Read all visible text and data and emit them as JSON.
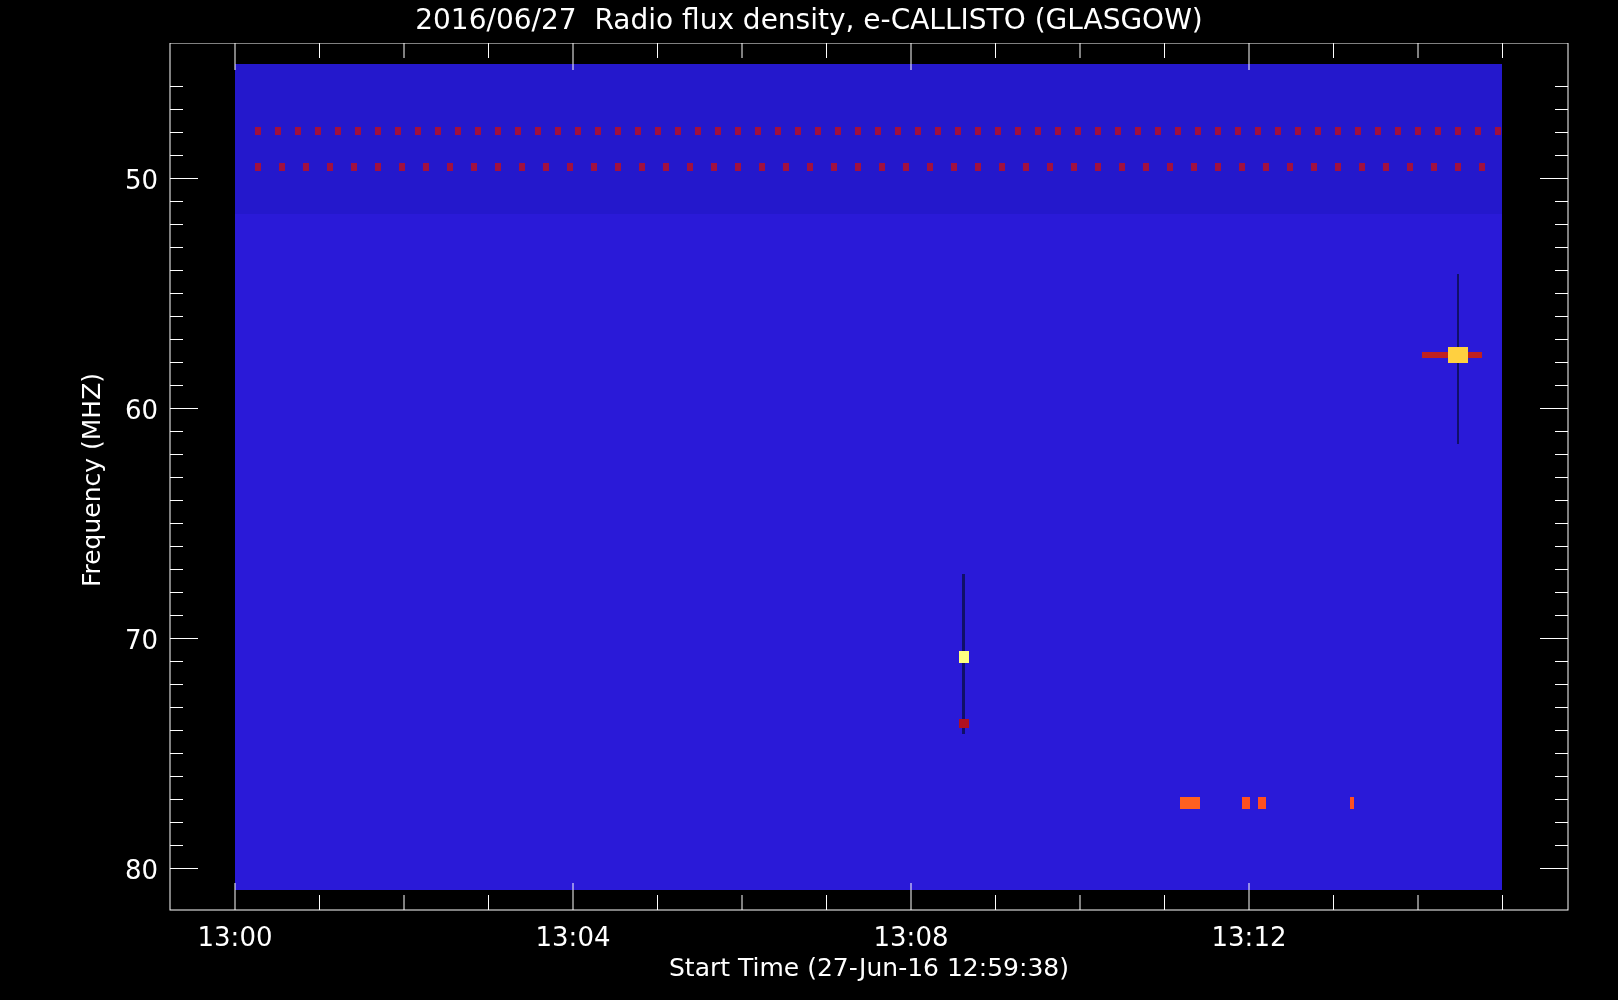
{
  "title": "2016/06/27  Radio flux density, e-CALLISTO (GLASGOW)",
  "plot": {
    "ylabel": "Frequency (MHZ)",
    "xlabel": "Start Time (27-Jun-16 12:59:38)",
    "yticks": [
      "50",
      "60",
      "70",
      "80"
    ],
    "xticks": [
      "13:00",
      "13:04",
      "13:08",
      "13:12"
    ]
  }
}
